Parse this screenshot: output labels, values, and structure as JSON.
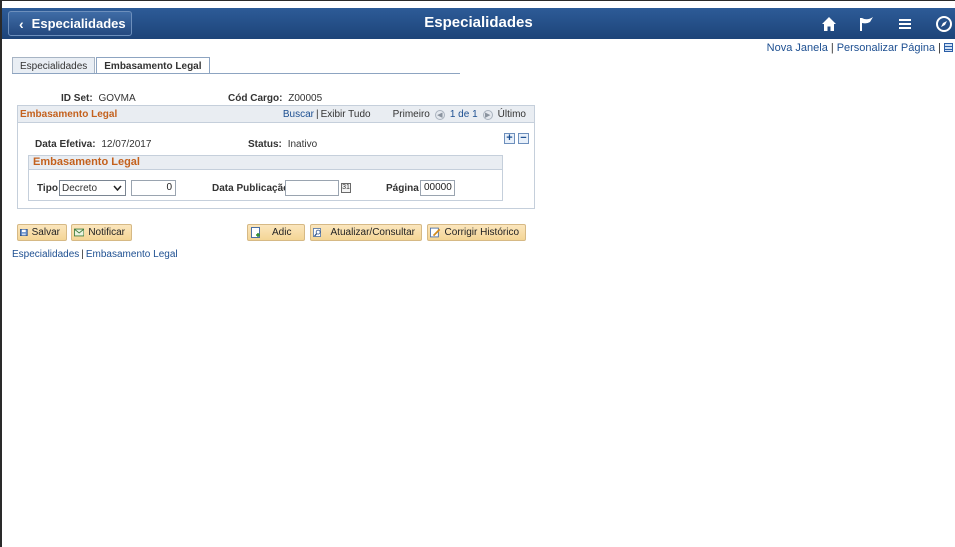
{
  "header": {
    "back_label": "Especialidades",
    "title": "Especialidades",
    "icons": [
      "home-icon",
      "flag-icon",
      "menu-icon",
      "compass-icon"
    ]
  },
  "top_links": {
    "new_window": "Nova Janela",
    "personalize": "Personalizar Página",
    "separator": "|"
  },
  "tabs": [
    {
      "label": "Especialidades",
      "active": false
    },
    {
      "label": "Embasamento Legal",
      "active": true
    }
  ],
  "form": {
    "setid_label": "ID Set:",
    "setid_value": "GOVMA",
    "cargo_label": "Cód Cargo:",
    "cargo_value": "Z00005"
  },
  "grid": {
    "title": "Embasamento Legal",
    "find": "Buscar",
    "sep": "|",
    "view_all": "Exibir Tudo",
    "first": "Primeiro",
    "range": "1 de 1",
    "last": "Último",
    "effdt_label": "Data Efetiva:",
    "effdt_value": "12/07/2017",
    "status_label": "Status:",
    "status_value": "Inativo"
  },
  "sub": {
    "title": "Embasamento Legal",
    "tipo_label": "Tipo",
    "tipo_value": "Decreto",
    "number_value": "0",
    "pub_label": "Data Publicação",
    "pub_value": "",
    "page_label": "Página",
    "page_value": "00000"
  },
  "buttons": {
    "save": "Salvar",
    "notify": "Notificar",
    "add": "Adic",
    "update": "Atualizar/Consultar",
    "correct": "Corrigir Histórico"
  },
  "bottom_links": {
    "first": "Especialidades",
    "sep": "|",
    "second": "Embasamento Legal"
  },
  "colors": {
    "banner": "#24497f",
    "section_title": "#c4611d",
    "link": "#1d4f91",
    "button": "#f4d595"
  }
}
